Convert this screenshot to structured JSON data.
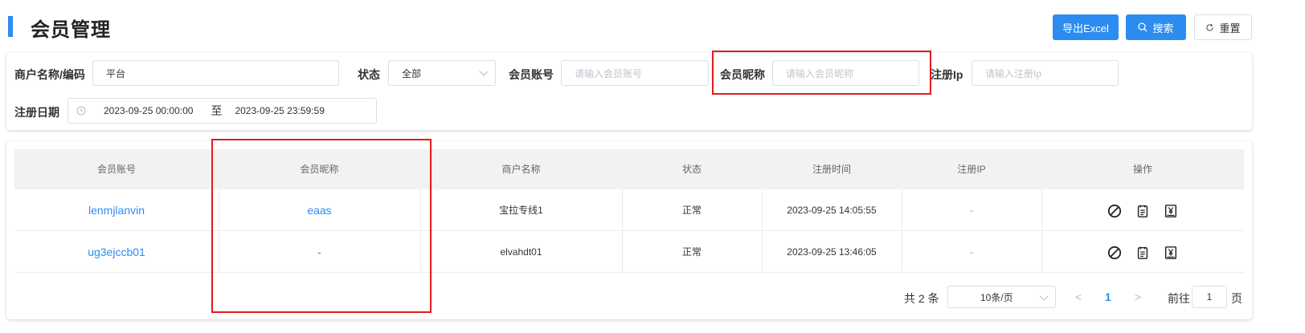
{
  "header": {
    "title": "会员管理",
    "export_label": "导出Excel",
    "search_label": "搜索",
    "reset_label": "重置"
  },
  "filters": {
    "merchant_label": "商户名称/编码",
    "merchant_value": "平台",
    "status_label": "状态",
    "status_value": "全部",
    "account_label": "会员账号",
    "account_placeholder": "请输入会员账号",
    "nickname_label": "会员昵称",
    "nickname_placeholder": "请输入会员昵称",
    "ip_label": "注册Ip",
    "ip_placeholder": "请输入注册Ip",
    "date_label": "注册日期",
    "date_start": "2023-09-25 00:00:00",
    "date_sep": "至",
    "date_end": "2023-09-25 23:59:59"
  },
  "table": {
    "columns": [
      "会员账号",
      "会员昵称",
      "商户名称",
      "状态",
      "注册时间",
      "注册IP",
      "操作"
    ],
    "rows": [
      {
        "account": "lenmjlanvin",
        "nickname": "eaas",
        "merchant": "宝拉专线1",
        "status": "正常",
        "reg_time": "2023-09-25 14:05:55",
        "reg_ip": "-"
      },
      {
        "account": "ug3ejccb01",
        "nickname": "-",
        "merchant": "elvahdt01",
        "status": "正常",
        "reg_time": "2023-09-25 13:46:05",
        "reg_ip": "-"
      }
    ]
  },
  "pagination": {
    "total_text": "共 2 条",
    "page_size": "10条/页",
    "prev": "<",
    "current_page": "1",
    "next": ">",
    "goto_label": "前往",
    "goto_value": "1",
    "goto_suffix": "页"
  },
  "colors": {
    "accent": "#2d8cf0",
    "highlight_box": "#e31b1b"
  }
}
